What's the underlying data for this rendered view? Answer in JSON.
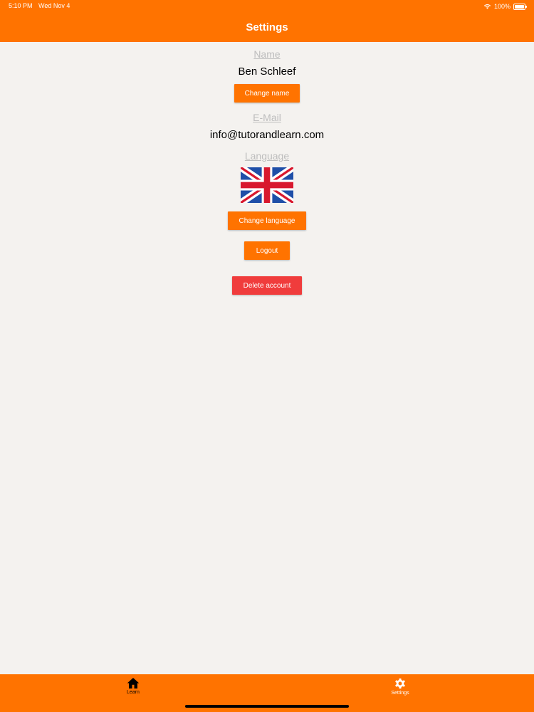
{
  "status_bar": {
    "time": "5:10 PM",
    "date": "Wed Nov 4",
    "battery": "100%",
    "icons": [
      "wifi-icon",
      "battery-icon"
    ]
  },
  "header": {
    "title": "Settings"
  },
  "profile": {
    "name_label": "Name",
    "name_value": "Ben Schleef",
    "change_name_label": "Change name",
    "email_label": "E-Mail",
    "email_value": "info@tutorandlearn.com",
    "language_label": "Language",
    "language_flag": "uk-flag-icon",
    "change_language_label": "Change language",
    "logout_label": "Logout",
    "delete_account_label": "Delete account"
  },
  "tab_bar": {
    "tabs": [
      {
        "label": "Learn",
        "icon": "home-icon"
      },
      {
        "label": "Settings",
        "icon": "gear-icon"
      }
    ]
  },
  "colors": {
    "accent": "#ff7300",
    "danger": "#f03c3c",
    "background": "#f4f2ef",
    "label_gray": "#bdbdbd"
  }
}
